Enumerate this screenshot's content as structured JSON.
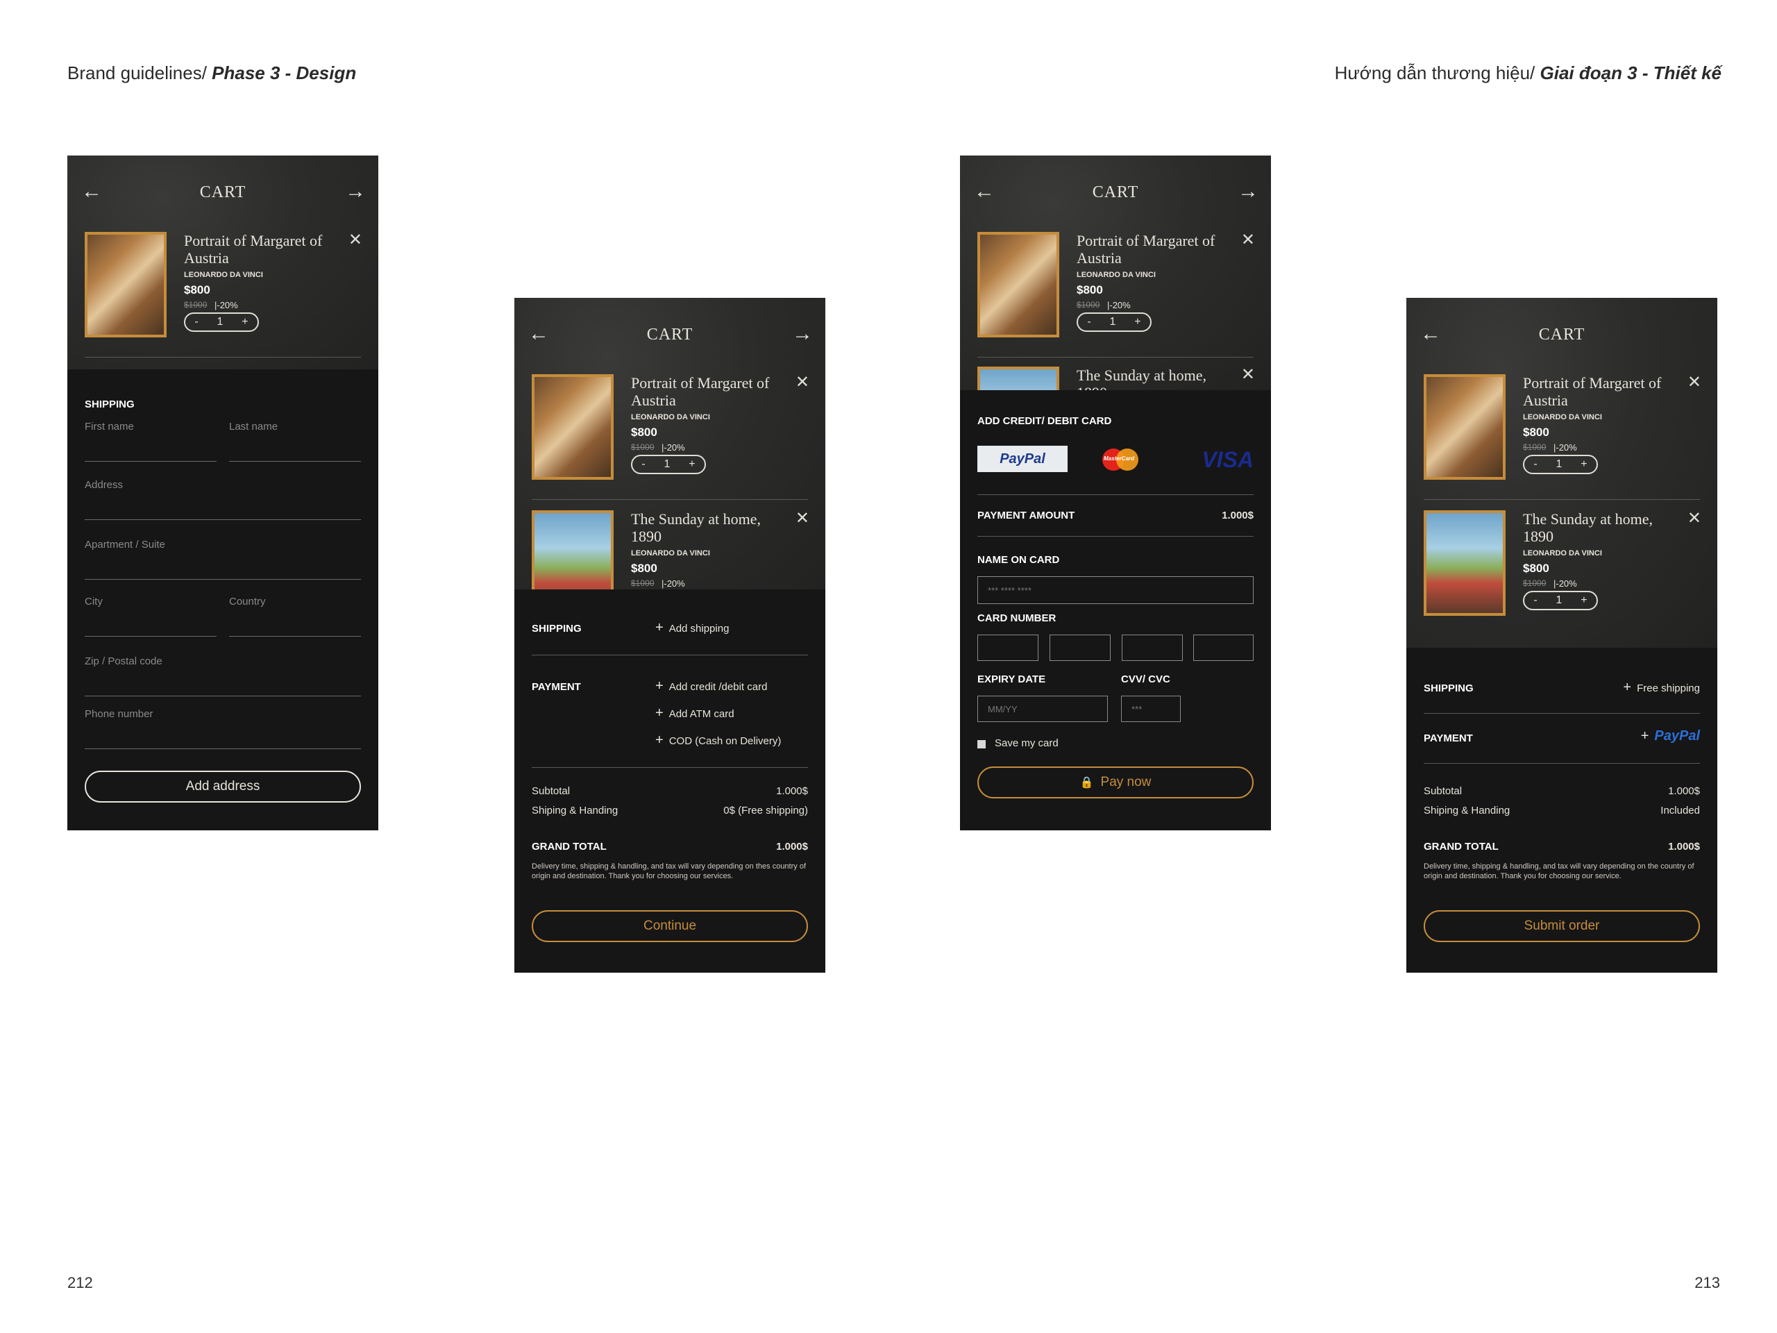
{
  "header": {
    "left_prefix": "Brand guidelines/ ",
    "left_bold": "Phase 3 - Design",
    "right_prefix": "Hướng dẫn thương hiệu/ ",
    "right_bold": "Giai đoạn 3 - Thiết kế"
  },
  "page_numbers": {
    "left": "212",
    "right": "213"
  },
  "colors": {
    "accent_gold": "#c58d3c",
    "panel_bg": "#161616",
    "text_light": "#e8e4dc"
  },
  "icons": {
    "back": "arrow-left-icon",
    "forward": "arrow-right-icon",
    "remove": "close-icon",
    "add": "plus-icon",
    "lock": "lock-icon"
  },
  "cart": {
    "title": "CART",
    "items": [
      {
        "title": "Portrait of Margaret of Austria",
        "artist": "LEONARDO DA VINCI",
        "price": "$800",
        "old_price": "$1000",
        "discount": "|-20%",
        "qty": "1",
        "minus": "-",
        "plus": "+"
      },
      {
        "title": "The Sunday at home, 1890",
        "artist": "LEONARDO DA VINCI",
        "price": "$800",
        "old_price": "$1000",
        "discount": "|-20%",
        "qty": "1",
        "minus": "-",
        "plus": "+"
      }
    ]
  },
  "screen1": {
    "shipping_label": "SHIPPING",
    "first_name": "First name",
    "last_name": "Last name",
    "address": "Address",
    "apartment": "Apartment / Suite",
    "city": "City",
    "country": "Country",
    "zip": "Zip / Postal code",
    "phone": "Phone number",
    "button": "Add address"
  },
  "screen2": {
    "shipping_label": "SHIPPING",
    "add_shipping": "Add shipping",
    "payment_label": "PAYMENT",
    "payment_options": [
      "Add credit /debit card",
      "Add ATM card",
      "COD (Cash on Delivery)"
    ],
    "subtotal_label": "Subtotal",
    "subtotal_value": "1.000$",
    "shipping_handling_label": "Shiping & Handing",
    "shipping_handling_value": "0$ (Free shipping)",
    "grand_total_label": "GRAND TOTAL",
    "grand_total_value": "1.000$",
    "note": "Delivery time, shipping & handling, and tax will vary depending on thes country of origin and destination. Thank you for choosing our services.",
    "button": "Continue"
  },
  "screen3": {
    "add_card_label": "ADD CREDIT/ DEBIT CARD",
    "paypal": "PayPal",
    "mastercard": "MasterCard",
    "visa": "VISA",
    "payment_amount_label": "PAYMENT AMOUNT",
    "payment_amount_value": "1.000$",
    "name_on_card_label": "NAME ON CARD",
    "name_placeholder": "*** **** ****",
    "card_number_label": "CARD NUMBER",
    "expiry_label": "EXPIRY DATE",
    "expiry_placeholder": "MM/YY",
    "cvv_label": "CVV/ CVC",
    "cvv_placeholder": "***",
    "save_card": "Save my card",
    "button": "Pay now"
  },
  "screen4": {
    "shipping_label": "SHIPPING",
    "free_shipping": "Free shipping",
    "payment_label": "PAYMENT",
    "paypal": "PayPal",
    "subtotal_label": "Subtotal",
    "subtotal_value": "1.000$",
    "shipping_handling_label": "Shiping & Handing",
    "shipping_handling_value": "Included",
    "grand_total_label": "GRAND TOTAL",
    "grand_total_value": "1.000$",
    "note": "Delivery time, shipping & handling, and tax will vary depending on the country of origin and destination. Thank you for choosing our service.",
    "button": "Submit order"
  }
}
